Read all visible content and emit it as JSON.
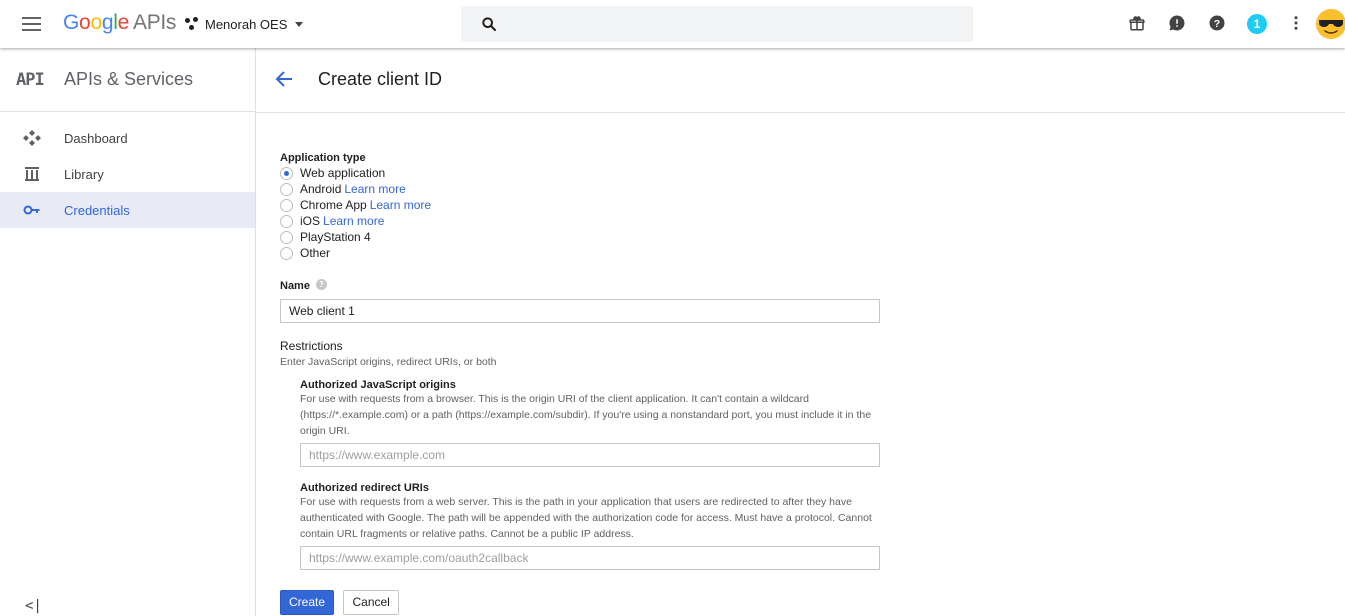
{
  "header": {
    "brand": {
      "G": "G",
      "o1": "o",
      "o2": "o",
      "g": "g",
      "l": "l",
      "e": "e",
      "apis": "APIs"
    },
    "project": "Menorah OES",
    "notifications_count": "1",
    "icons": [
      "menu-icon",
      "project-icon",
      "search-icon",
      "gift-icon",
      "feedback-icon",
      "help-icon",
      "more-vert-icon",
      "avatar"
    ]
  },
  "sidebar": {
    "logo": "API",
    "title": "APIs & Services",
    "items": [
      {
        "label": "Dashboard",
        "icon": "dashboard-icon",
        "active": false
      },
      {
        "label": "Library",
        "icon": "library-icon",
        "active": false
      },
      {
        "label": "Credentials",
        "icon": "key-icon",
        "active": true
      }
    ],
    "collapse": "<|"
  },
  "page": {
    "title": "Create client ID"
  },
  "form": {
    "app_type_label": "Application type",
    "app_types": [
      {
        "label": "Web application",
        "link": "",
        "checked": true
      },
      {
        "label": "Android",
        "link": "Learn more",
        "checked": false
      },
      {
        "label": "Chrome App",
        "link": "Learn more",
        "checked": false
      },
      {
        "label": "iOS",
        "link": "Learn more",
        "checked": false
      },
      {
        "label": "PlayStation 4",
        "link": "",
        "checked": false
      },
      {
        "label": "Other",
        "link": "",
        "checked": false
      }
    ],
    "name_label": "Name",
    "name_value": "Web client 1",
    "restrictions_title": "Restrictions",
    "restrictions_desc": "Enter JavaScript origins, redirect URIs, or both",
    "js_origins": {
      "title": "Authorized JavaScript origins",
      "desc": "For use with requests from a browser. This is the origin URI of the client application. It can't contain a wildcard (https://*.example.com) or a path (https://example.com/subdir). If you're using a nonstandard port, you must include it in the origin URI.",
      "placeholder": "https://www.example.com"
    },
    "redirect_uris": {
      "title": "Authorized redirect URIs",
      "desc": "For use with requests from a web server. This is the path in your application that users are redirected to after they have authenticated with Google. The path will be appended with the authorization code for access. Must have a protocol. Cannot contain URL fragments or relative paths. Cannot be a public IP address.",
      "placeholder": "https://www.example.com/oauth2callback"
    },
    "create_label": "Create",
    "cancel_label": "Cancel"
  },
  "colors": {
    "accent": "#3367d6",
    "active_bg": "#e8eaf6",
    "badge": "#1ecbf2"
  }
}
